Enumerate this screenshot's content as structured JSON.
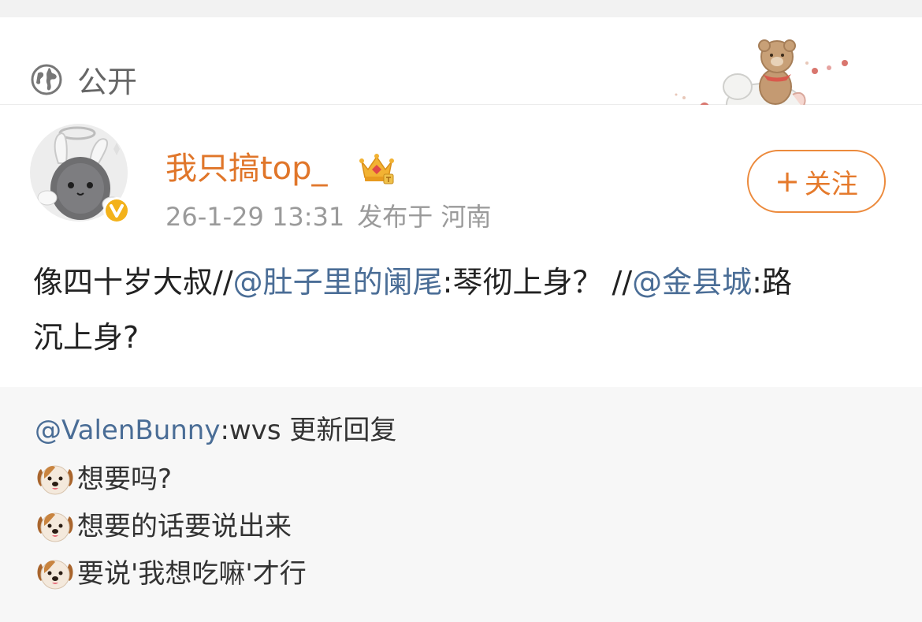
{
  "visibility": {
    "label": "公开",
    "icon": "globe-icon"
  },
  "post": {
    "username": "我只搞top_",
    "timestamp": "26-1-29 13:31",
    "source": "发布于 河南",
    "follow_label": "关注",
    "text": {
      "part1": "像四十岁大叔",
      "sep1": "//",
      "mention1": "@肚子里的阑尾",
      "part2": ":琴彻上身？",
      "sep2": "//",
      "mention2": "@金县城",
      "part3": ":路",
      "line2": "沉上身?"
    }
  },
  "repost": {
    "author": "@ValenBunny",
    "header_rest": ":wvs 更新回复",
    "lines": [
      "想要吗?",
      "想要的话要说出来",
      "要说'我想吃嘛'才行"
    ],
    "emoji": "dog-face-emoji"
  },
  "colors": {
    "accent": "#e0762a",
    "mention": "#4a6d96",
    "meta": "#9a9a9a",
    "verified": "#f3b21b"
  }
}
